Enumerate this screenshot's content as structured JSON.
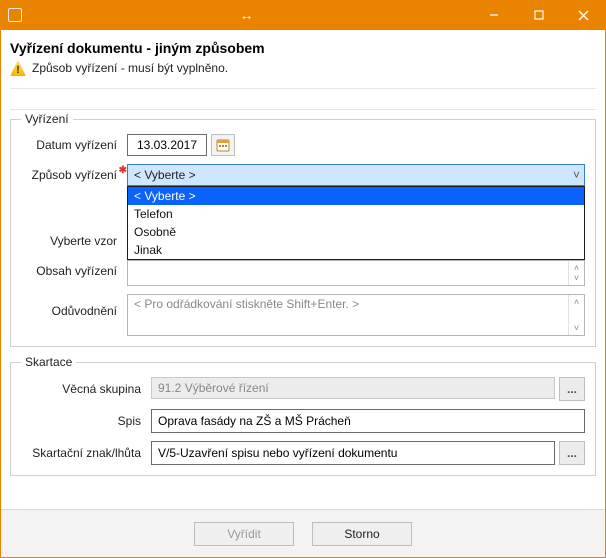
{
  "titlebar": {
    "double_arrow_glyph": "↔"
  },
  "header": {
    "title": "Vyřízení dokumentu - jiným způsobem",
    "warning_text": "Způsob vyřízení - musí být vyplněno."
  },
  "vyrizeni": {
    "legend": "Vyřízení",
    "datum_label": "Datum vyřízení",
    "datum_value": "13.03.2017",
    "zpusob_label": "Způsob vyřízení",
    "zpusob_selected": "< Vyberte >",
    "zpusob_options": {
      "opt0": "< Vyberte >",
      "opt1": "Telefon",
      "opt2": "Osobně",
      "opt3": "Jinak"
    },
    "vzor_label": "Vyberte vzor",
    "obsah_label": "Obsah vyřízení",
    "oduvodneni_label": "Odůvodnění",
    "oduvodneni_placeholder": "< Pro odřádkování stiskněte Shift+Enter. >"
  },
  "skartace": {
    "legend": "Skartace",
    "vecna_label": "Věcná skupina",
    "vecna_value": "91.2 Výběrové řízení",
    "spis_label": "Spis",
    "spis_value": "Oprava fasády na ZŠ a MŠ Prácheň",
    "znak_label": "Skartační znak/lhůta",
    "znak_value": "V/5-Uzavření spisu nebo vyřízení dokumentu"
  },
  "footer": {
    "primary": "Vyřídit",
    "cancel": "Storno"
  },
  "glyphs": {
    "chevron": "˅",
    "spin_up": "˄",
    "spin_down": "˅",
    "ellipsis": "..."
  }
}
